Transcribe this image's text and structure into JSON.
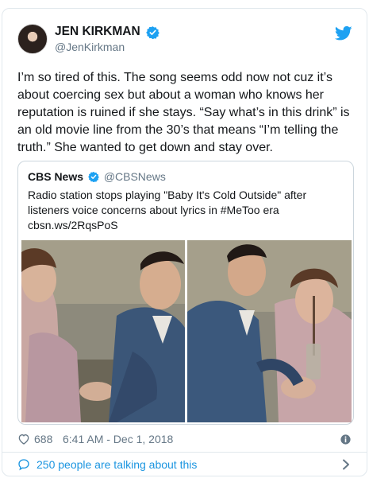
{
  "author": {
    "name": "JEN KIRKMAN",
    "handle": "@JenKirkman"
  },
  "tweet": {
    "text": "I’m so tired of this. The song seems odd now not cuz it’s about coercing sex but about a woman who knows her reputation is ruined if she stays. “Say what’s in this drink” is an old movie line from the 30’s that means “I’m telling the truth.” She wanted to get down and stay over."
  },
  "quote": {
    "name": "CBS News",
    "handle": "@CBSNews",
    "text": "Radio station stops playing \"Baby It's Cold Outside\" after listeners voice concerns about lyrics in #MeToo era",
    "link": "cbsn.ws/2RqsPoS"
  },
  "meta": {
    "likes": "688",
    "timestamp": "6:41 AM - Dec 1, 2018"
  },
  "footer": {
    "talking": "250 people are talking about this"
  },
  "icons": {
    "verified": "verified-badge-icon",
    "bird": "twitter-bird-icon",
    "heart": "heart-icon",
    "info": "info-icon",
    "comment": "comment-icon",
    "chevron": "chevron-right-icon"
  },
  "colors": {
    "twitter_blue": "#1da1f2",
    "link_blue": "#1b95e0",
    "text": "#14171a",
    "secondary_text": "#657786",
    "border": "#e1e8ed"
  }
}
